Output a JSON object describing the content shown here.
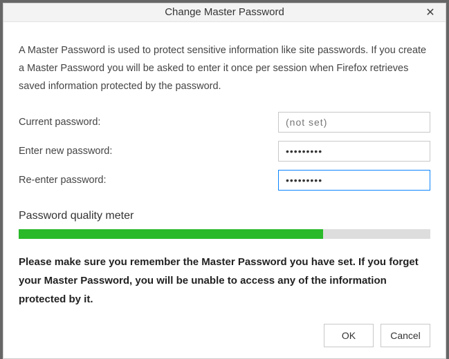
{
  "dialog": {
    "title": "Change Master Password",
    "description": "A Master Password is used to protect sensitive information like site passwords. If you create a Master Password you will be asked to enter it once per session when Firefox retrieves saved information protected by the password.",
    "fields": {
      "current_label": "Current password:",
      "current_placeholder": "(not set)",
      "current_value": "",
      "new_label": "Enter new password:",
      "new_value": "•••••••••",
      "reenter_label": "Re-enter password:",
      "reenter_value": "•••••••••"
    },
    "meter": {
      "label": "Password quality meter",
      "percent": 74,
      "fill_color": "#29b929"
    },
    "warning": "Please make sure you remember the Master Password you have set. If you forget your Master Password, you will be unable to access any of the information protected by it.",
    "buttons": {
      "ok": "OK",
      "cancel": "Cancel"
    },
    "close_glyph": "✕"
  }
}
